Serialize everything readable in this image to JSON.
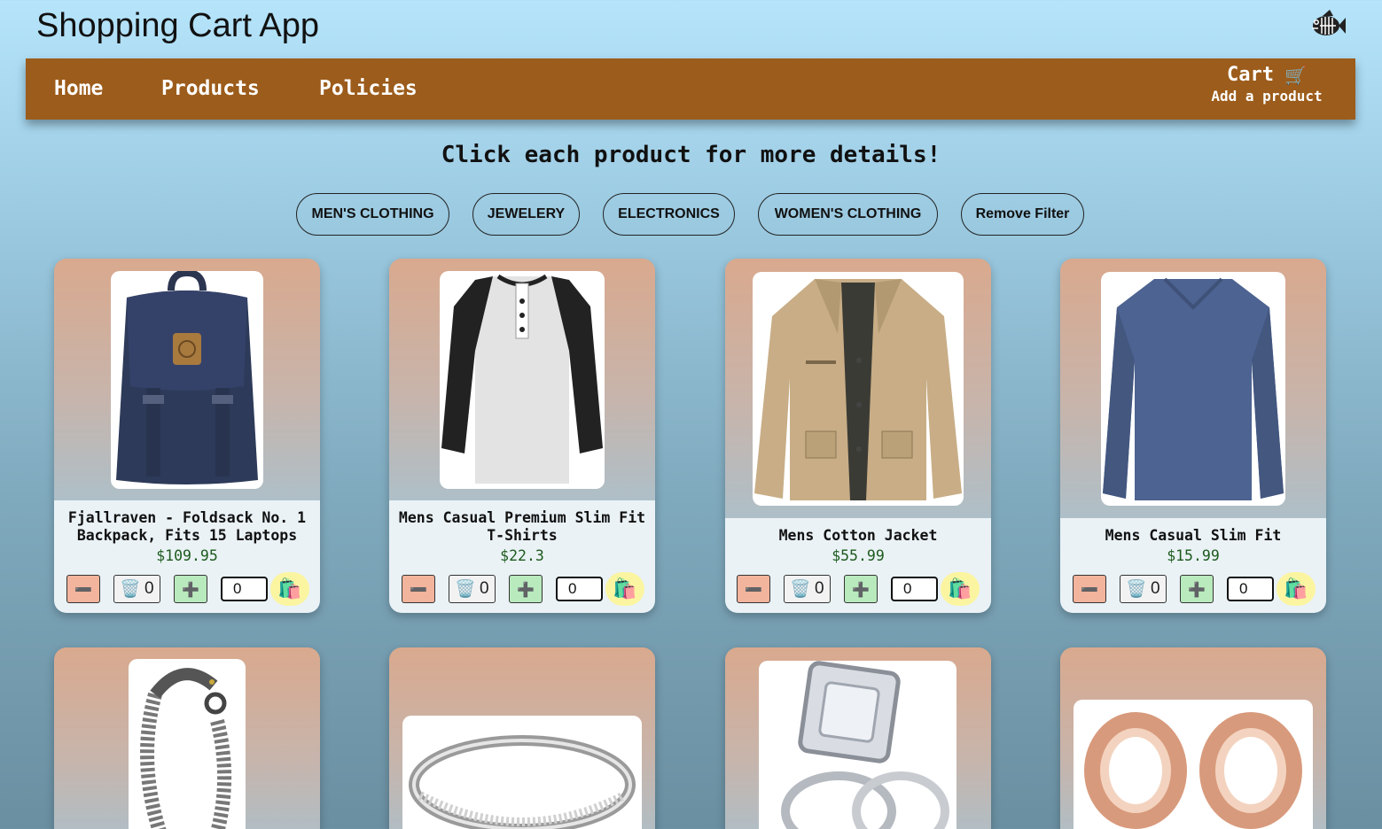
{
  "app": {
    "title": "Shopping Cart App",
    "logo_icon": "fish-skeleton-icon"
  },
  "nav": {
    "links": [
      "Home",
      "Products",
      "Policies"
    ],
    "cart_label": "Cart",
    "cart_icon": "🛒",
    "cart_sub": "Add a product",
    "bg_color": "#9c5c1b"
  },
  "headline": "Click each product for more details!",
  "filters": [
    "MEN'S CLOTHING",
    "JEWELERY",
    "ELECTRONICS",
    "WOMEN'S CLOTHING",
    "Remove Filter"
  ],
  "products": [
    {
      "title": "Fjallraven - Foldsack No. 1 Backpack, Fits 15 Laptops",
      "price": "$109.95",
      "count": "0",
      "qty": "0",
      "image": "navy-backpack"
    },
    {
      "title": "Mens Casual Premium Slim Fit T-Shirts",
      "price": "$22.3",
      "count": "0",
      "qty": "0",
      "image": "raglan-henley-shirt"
    },
    {
      "title": "Mens Cotton Jacket",
      "price": "$55.99",
      "count": "0",
      "qty": "0",
      "image": "khaki-jacket"
    },
    {
      "title": "Mens Casual Slim Fit",
      "price": "$15.99",
      "count": "0",
      "qty": "0",
      "image": "blue-long-sleeve-shirt"
    },
    {
      "image": "dragon-chain-bracelet"
    },
    {
      "image": "silver-eternity-ring"
    },
    {
      "image": "diamond-wedding-ring-set"
    },
    {
      "image": "rose-gold-tunnel-plugs"
    }
  ],
  "icons": {
    "minus": "➖",
    "trash": "🗑️",
    "plus": "➕",
    "bag": "🛍️"
  },
  "colors": {
    "price": "#1d5a1d",
    "minus_btn": "#f2b49c",
    "plus_btn": "#b9eabd",
    "bag_btn": "#fbf5a1"
  }
}
